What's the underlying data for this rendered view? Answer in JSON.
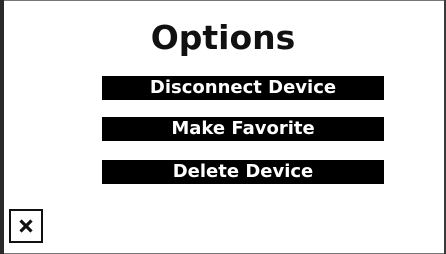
{
  "dialog": {
    "title": "Options",
    "buttons": [
      {
        "label": "Disconnect Device"
      },
      {
        "label": "Make Favorite"
      },
      {
        "label": "Delete Device"
      }
    ],
    "close_icon": "close-icon"
  },
  "colors": {
    "background": "#ffffff",
    "button_background": "#000000",
    "button_text": "#ffffff",
    "title_text": "#111111"
  }
}
